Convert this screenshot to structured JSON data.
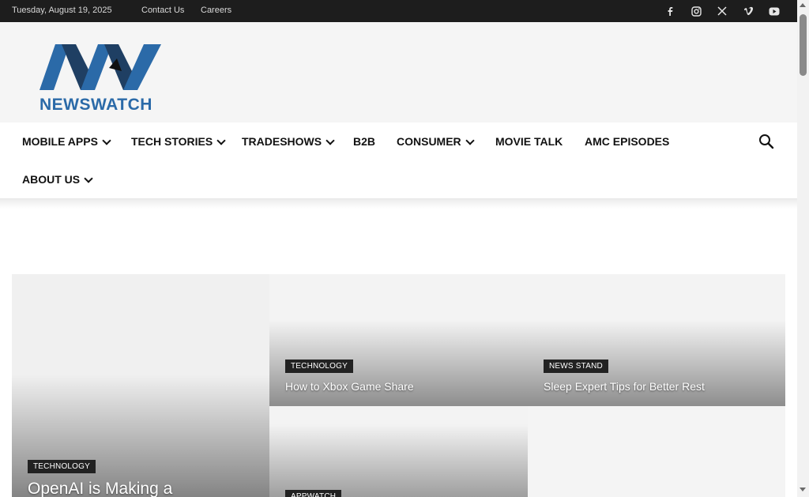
{
  "topbar": {
    "date": "Tuesday, August 19, 2025",
    "links": [
      "Contact Us",
      "Careers"
    ],
    "social_icons": [
      "facebook-icon",
      "instagram-icon",
      "x-icon",
      "vimeo-icon",
      "youtube-icon"
    ]
  },
  "header": {
    "logo_text": "NEWSWATCH",
    "logo_color": "#2b6aa8"
  },
  "nav": {
    "items": [
      {
        "label": "MOBILE APPS",
        "dropdown": true
      },
      {
        "label": "TECH STORIES",
        "dropdown": true
      },
      {
        "label": "TRADESHOWS",
        "dropdown": true
      },
      {
        "label": "B2B",
        "dropdown": false
      },
      {
        "label": "CONSUMER",
        "dropdown": true
      },
      {
        "label": "MOVIE TALK",
        "dropdown": false
      },
      {
        "label": "AMC EPISODES",
        "dropdown": false
      },
      {
        "label": "ABOUT US",
        "dropdown": true
      }
    ],
    "search_icon": "search-icon"
  },
  "grid": {
    "main": {
      "category": "TECHNOLOGY",
      "title": "OpenAI is Making a"
    },
    "tiles": [
      {
        "category": "TECHNOLOGY",
        "title": "How to Xbox Game Share"
      },
      {
        "category": "NEWS STAND",
        "title": "Sleep Expert Tips for Better Rest"
      },
      {
        "category": "APPWATCH",
        "title": ""
      }
    ]
  }
}
